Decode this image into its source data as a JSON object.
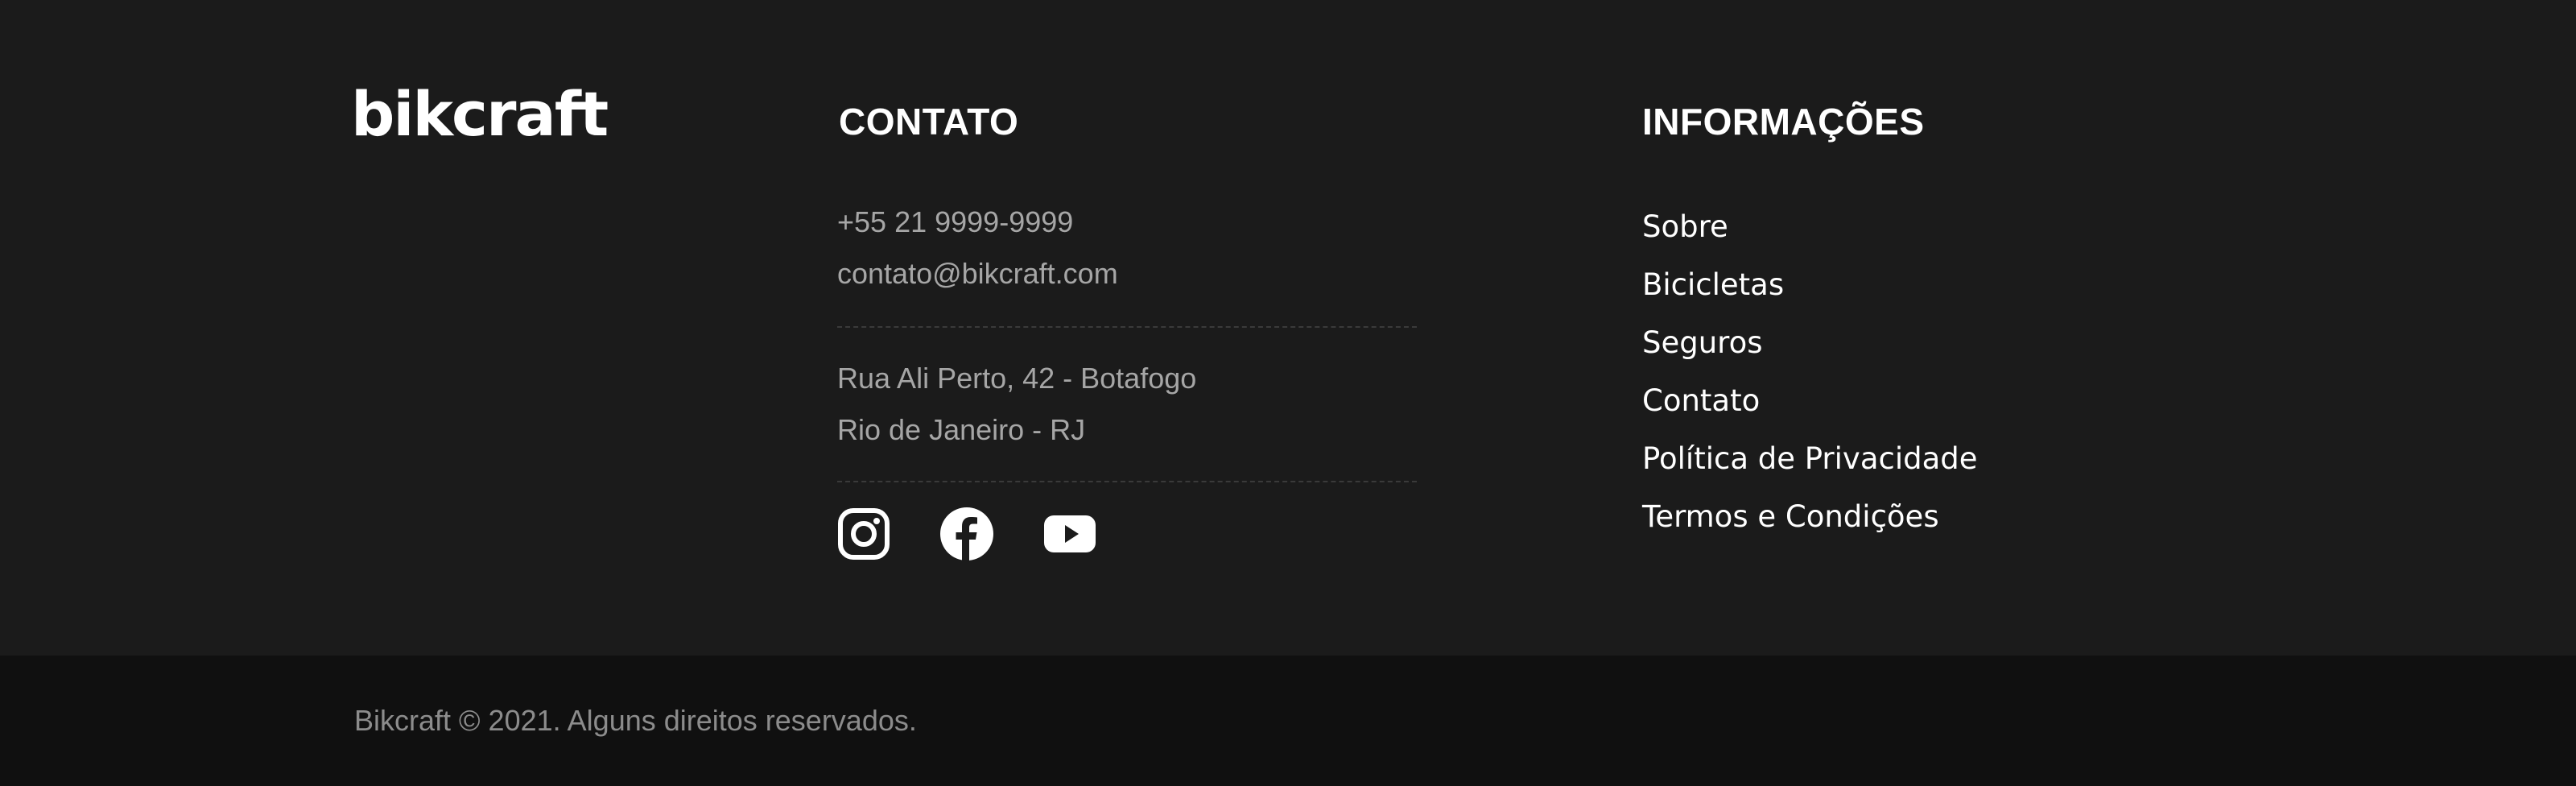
{
  "brand": {
    "logo_text": "bikcraft"
  },
  "contact": {
    "title": "CONTATO",
    "phone": "+55 21 9999-9999",
    "email": "contato@bikcraft.com",
    "address_line1": "Rua Ali Perto, 42 - Botafogo",
    "address_line2": "Rio de Janeiro - RJ",
    "socials": [
      {
        "name": "instagram-icon"
      },
      {
        "name": "facebook-icon"
      },
      {
        "name": "youtube-icon"
      }
    ]
  },
  "info": {
    "title": "INFORMAÇÕES",
    "links": [
      "Sobre",
      "Bicicletas",
      "Seguros",
      "Contato",
      "Política de Privacidade",
      "Termos e Condições"
    ]
  },
  "footer": {
    "copyright": "Bikcraft © 2021. Alguns direitos reservados."
  },
  "colors": {
    "background": "#1b1b1b",
    "bottom_bar": "#101010",
    "text_primary": "#ffffff",
    "text_muted": "#a6a6a6"
  }
}
